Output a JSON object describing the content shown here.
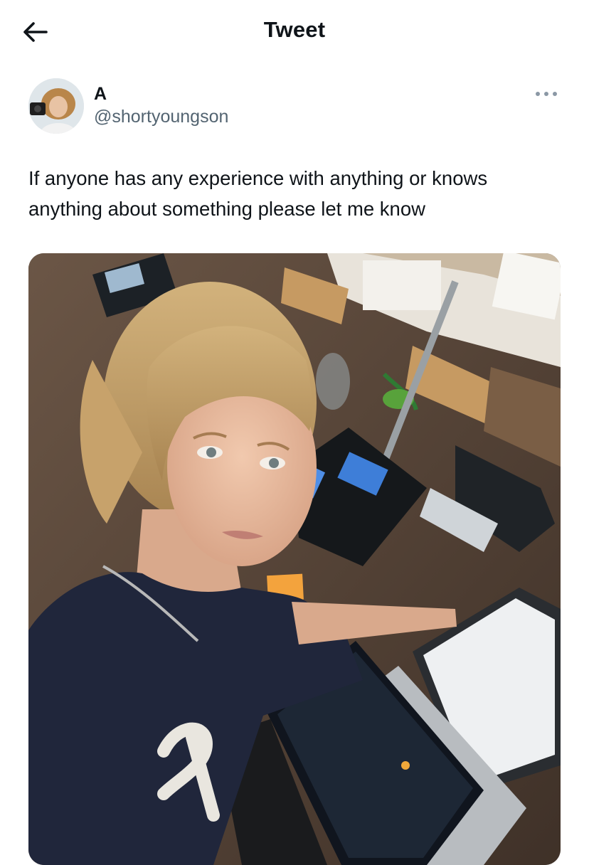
{
  "header": {
    "title": "Tweet",
    "back_icon": "arrow-left-icon"
  },
  "author": {
    "display_name": "A",
    "handle": "@shortyoungson",
    "avatar_icon": "user-avatar",
    "more_icon": "more-horizontal-icon"
  },
  "tweet": {
    "text_line1": "If anyone has any experience with anything or knows",
    "text_line2": "anything about something please let me know"
  },
  "media": {
    "kind": "photo"
  },
  "colors": {
    "text": "#0f1419",
    "secondary": "#536471",
    "background": "#ffffff"
  }
}
